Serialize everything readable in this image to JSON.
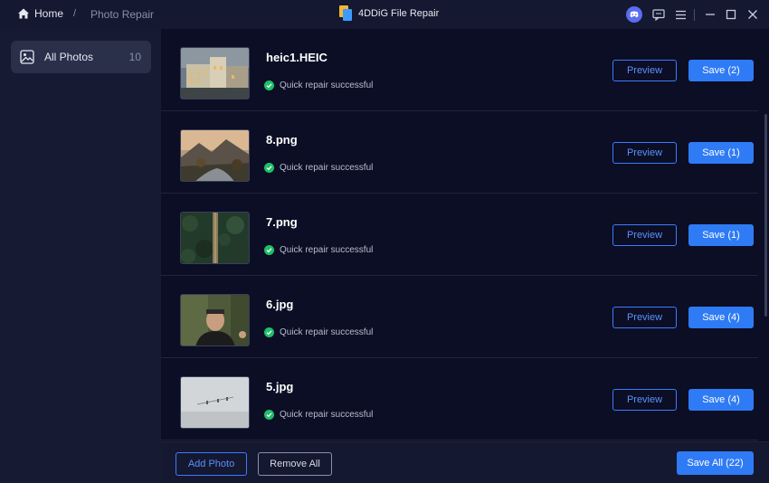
{
  "breadcrumb": {
    "home": "Home",
    "separator": "/",
    "current": "Photo Repair"
  },
  "app": {
    "title": "4DDiG File Repair"
  },
  "sidebar": {
    "items": [
      {
        "label": "All Photos",
        "count": "10",
        "icon": "image-icon"
      }
    ]
  },
  "files": [
    {
      "name": "heic1.HEIC",
      "status": "Quick repair successful",
      "preview": "Preview",
      "save": "Save (2)",
      "thumb": "building"
    },
    {
      "name": "8.png",
      "status": "Quick repair successful",
      "preview": "Preview",
      "save": "Save (1)",
      "thumb": "mountain-lake"
    },
    {
      "name": "7.png",
      "status": "Quick repair successful",
      "preview": "Preview",
      "save": "Save (1)",
      "thumb": "forest"
    },
    {
      "name": "6.jpg",
      "status": "Quick repair successful",
      "preview": "Preview",
      "save": "Save (4)",
      "thumb": "portrait"
    },
    {
      "name": "5.jpg",
      "status": "Quick repair successful",
      "preview": "Preview",
      "save": "Save (4)",
      "thumb": "foggy-sky"
    }
  ],
  "footer": {
    "add_photo": "Add Photo",
    "remove_all": "Remove All",
    "save_all": "Save All (22)"
  },
  "colors": {
    "accent": "#2f7bf5",
    "success": "#1fbf6a",
    "background": "#0d1026"
  }
}
